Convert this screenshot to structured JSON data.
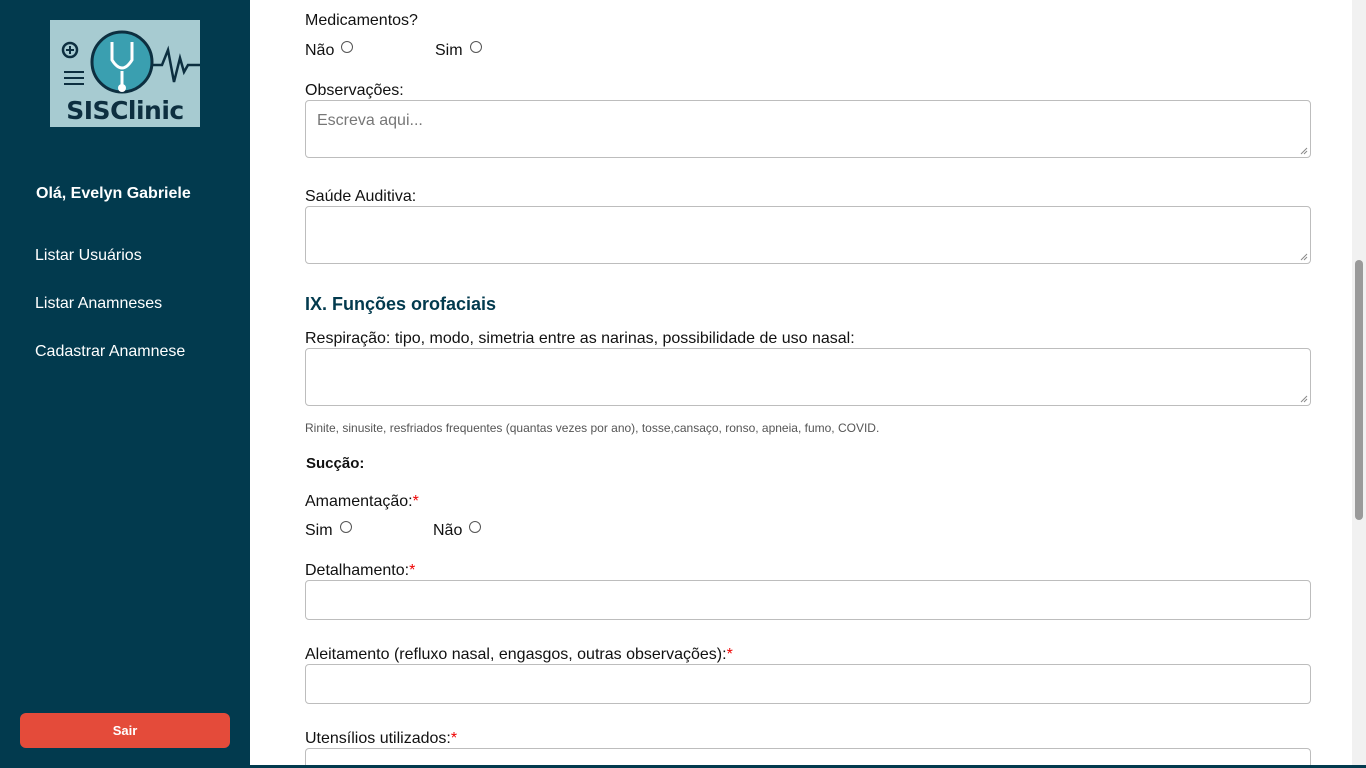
{
  "sidebar": {
    "logo_text": "SISClinic",
    "greeting": "Olá, Evelyn Gabriele",
    "nav": [
      {
        "label": "Listar Usuários"
      },
      {
        "label": "Listar Anamneses"
      },
      {
        "label": "Cadastrar Anamnese"
      }
    ],
    "logout_label": "Sair",
    "colors": {
      "background": "#023a4e",
      "logout": "#e44b3a"
    }
  },
  "form": {
    "medicamentos": {
      "label": "Medicamentos?",
      "options": [
        "Não",
        "Sim"
      ]
    },
    "observacoes": {
      "label": "Observações:",
      "placeholder": "Escreva aqui..."
    },
    "saude_auditiva": {
      "label": "Saúde Auditiva:"
    },
    "section_title": "IX. Funções orofaciais",
    "respiracao": {
      "label": "Respiração: tipo, modo, simetria entre as narinas, possibilidade de uso nasal:",
      "hint": "Rinite, sinusite, resfriados frequentes (quantas vezes por ano), tosse,cansaço, ronso, apneia, fumo, COVID."
    },
    "succao_heading": "Sucção:",
    "amamentacao": {
      "label": "Amamentação:",
      "required_mark": "*",
      "options": [
        "Sim",
        "Não"
      ]
    },
    "detalhamento": {
      "label": "Detalhamento:",
      "required_mark": "*"
    },
    "aleitamento": {
      "label": "Aleitamento (refluxo nasal, engasgos, outras observações):",
      "required_mark": "*"
    },
    "utensilios": {
      "label": "Utensílios utilizados:",
      "required_mark": "*"
    },
    "colors": {
      "section_title": "#023a4e",
      "required": "#e00000"
    }
  }
}
